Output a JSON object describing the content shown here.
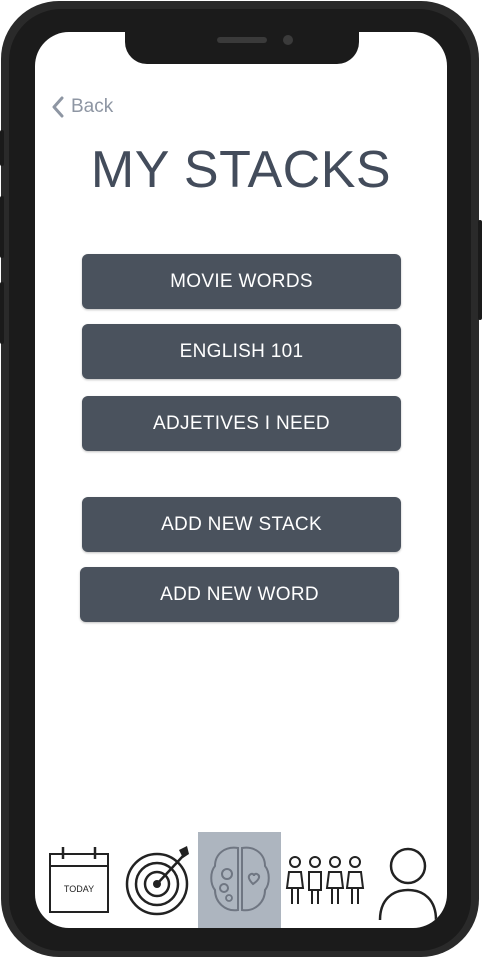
{
  "header": {
    "back_label": "Back",
    "title": "MY STACKS"
  },
  "stacks": [
    {
      "label": "MOVIE WORDS"
    },
    {
      "label": "ENGLISH 101"
    },
    {
      "label": "ADJETIVES I NEED"
    }
  ],
  "actions": {
    "add_stack_label": "ADD NEW STACK",
    "add_word_label": "ADD NEW WORD"
  },
  "tabbar": {
    "today_label": "TODAY",
    "active_tab": "brain",
    "active_color": "#adb5bf"
  },
  "colors": {
    "button": "#4a525d",
    "title": "#434c5b",
    "back": "#8e96a3"
  }
}
